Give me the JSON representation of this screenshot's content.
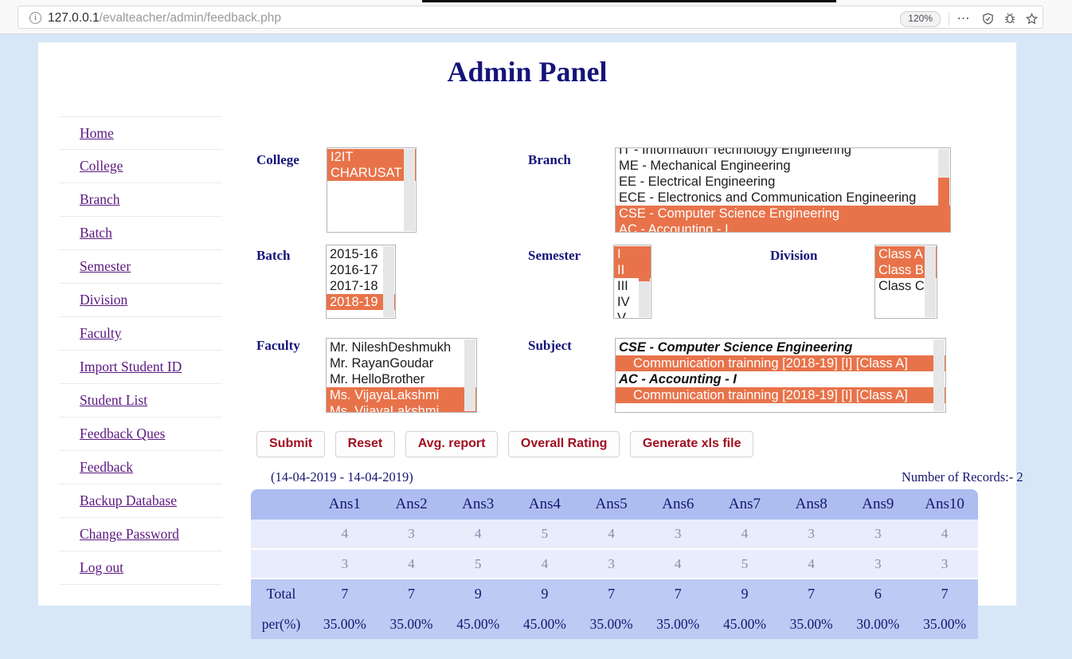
{
  "browser": {
    "url_host": "127.0.0.1",
    "url_path": "/evalteacher/admin/feedback.php",
    "zoom_level": "120%",
    "info_glyph": "i"
  },
  "page": {
    "title": "Admin Panel",
    "background_color": "#d7e7f7",
    "accent_selection_color": "#e8734a",
    "title_color": "#14147a"
  },
  "sidebar": {
    "items": [
      {
        "label": "Home"
      },
      {
        "label": "College"
      },
      {
        "label": "Branch"
      },
      {
        "label": "Batch"
      },
      {
        "label": "Semester"
      },
      {
        "label": "Division"
      },
      {
        "label": "Faculty"
      },
      {
        "label": "Import Student ID"
      },
      {
        "label": "Student List"
      },
      {
        "label": "Feedback Ques"
      },
      {
        "label": "Feedback"
      },
      {
        "label": "Backup Database"
      },
      {
        "label": "Change Password"
      },
      {
        "label": "Log out"
      }
    ]
  },
  "form": {
    "college": {
      "label": "College",
      "options": [
        {
          "text": "I2IT CHARUSAT",
          "selected": true
        }
      ]
    },
    "branch": {
      "label": "Branch",
      "options": [
        {
          "text": "IT - Information Technology Engineering",
          "selected": false
        },
        {
          "text": "ME - Mechanical Engineering",
          "selected": false
        },
        {
          "text": "EE - Electrical Engineering",
          "selected": false
        },
        {
          "text": "ECE - Electronics and Communication Engineering",
          "selected": false
        },
        {
          "text": "CSE - Computer Science Engineering",
          "selected": true
        },
        {
          "text": "AC - Accounting - I",
          "selected": true
        }
      ]
    },
    "batch": {
      "label": "Batch",
      "options": [
        {
          "text": "2015-16",
          "selected": false
        },
        {
          "text": "2016-17",
          "selected": false
        },
        {
          "text": "2017-18",
          "selected": false
        },
        {
          "text": "2018-19",
          "selected": true
        }
      ]
    },
    "semester": {
      "label": "Semester",
      "options": [
        {
          "text": "I",
          "selected": true
        },
        {
          "text": "II",
          "selected": true
        },
        {
          "text": "III",
          "selected": false
        },
        {
          "text": "IV",
          "selected": false
        },
        {
          "text": "V",
          "selected": false
        }
      ]
    },
    "division": {
      "label": "Division",
      "options": [
        {
          "text": "Class A",
          "selected": true
        },
        {
          "text": "Class B",
          "selected": true
        },
        {
          "text": "Class C",
          "selected": false
        }
      ]
    },
    "faculty": {
      "label": "Faculty",
      "options": [
        {
          "text": "Mr. NileshDeshmukh",
          "selected": false
        },
        {
          "text": "Mr. RayanGoudar",
          "selected": false
        },
        {
          "text": "Mr. HelloBrother",
          "selected": false
        },
        {
          "text": "Ms. VijayaLakshmi",
          "selected": true
        },
        {
          "text": "Ms. VijayaLakshmi",
          "selected": true
        }
      ]
    },
    "subject": {
      "label": "Subject",
      "groups": [
        {
          "group_label": "CSE - Computer Science Engineering",
          "options": [
            {
              "text": "Communication trainning [2018-19] [I] [Class A]",
              "selected": true
            }
          ]
        },
        {
          "group_label": "AC - Accounting - I",
          "options": [
            {
              "text": "Communication trainning [2018-19] [I] [Class A]",
              "selected": true
            }
          ]
        }
      ]
    }
  },
  "buttons": [
    {
      "label": "Submit"
    },
    {
      "label": "Reset"
    },
    {
      "label": "Avg. report"
    },
    {
      "label": "Overall Rating"
    },
    {
      "label": "Generate xls file"
    }
  ],
  "results": {
    "date_range": "(14-04-2019 - 14-04-2019)",
    "record_count_text": "Number of Records:- 2",
    "headers": [
      "",
      "Ans1",
      "Ans2",
      "Ans3",
      "Ans4",
      "Ans5",
      "Ans6",
      "Ans7",
      "Ans8",
      "Ans9",
      "Ans10"
    ],
    "rows": [
      {
        "label": "",
        "values": [
          "4",
          "3",
          "4",
          "5",
          "4",
          "3",
          "4",
          "3",
          "3",
          "4"
        ]
      },
      {
        "label": "",
        "values": [
          "3",
          "4",
          "5",
          "4",
          "3",
          "4",
          "5",
          "4",
          "3",
          "3"
        ]
      }
    ],
    "total": {
      "label": "Total",
      "values": [
        "7",
        "7",
        "9",
        "9",
        "7",
        "7",
        "9",
        "7",
        "6",
        "7"
      ]
    },
    "percent": {
      "label": "per(%)",
      "values": [
        "35.00%",
        "35.00%",
        "45.00%",
        "45.00%",
        "35.00%",
        "35.00%",
        "45.00%",
        "35.00%",
        "30.00%",
        "35.00%"
      ]
    }
  }
}
